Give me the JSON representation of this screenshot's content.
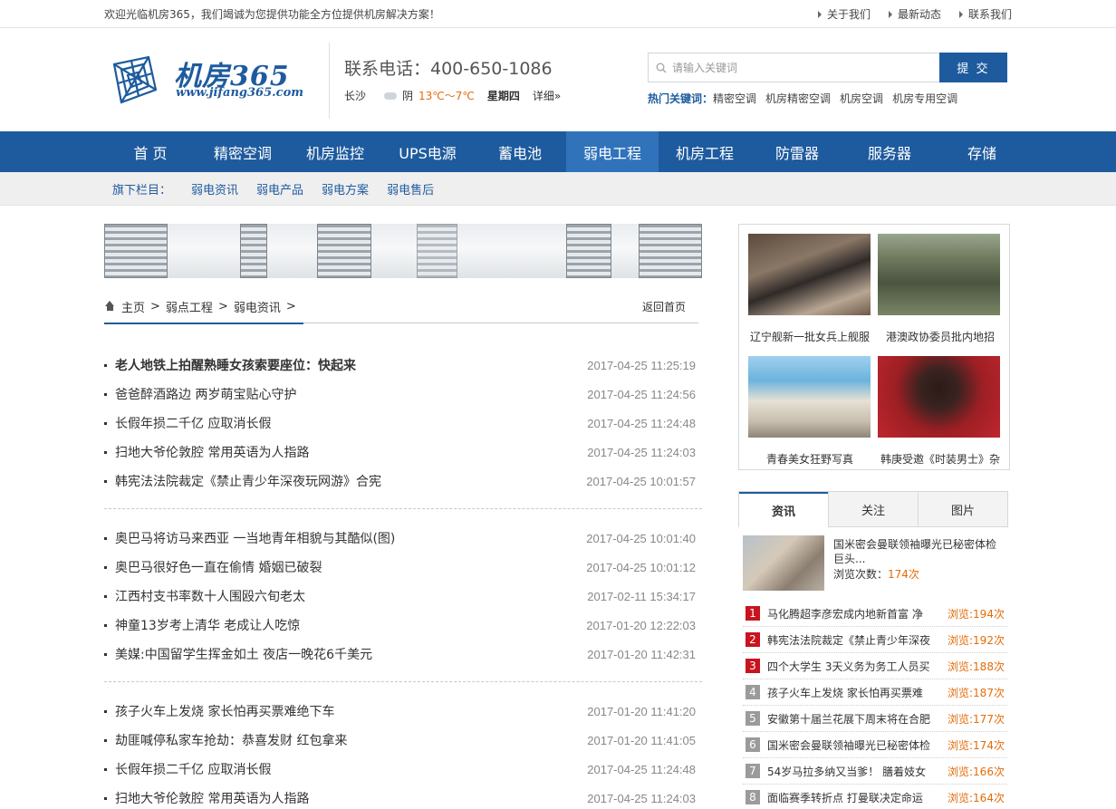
{
  "topbar": {
    "welcome": "欢迎光临机房365，我们竭诚为您提供功能全方位提供机房解决方案！",
    "links": [
      "关于我们",
      "最新动态",
      "联系我们"
    ]
  },
  "header": {
    "logo_main": "机房365",
    "logo_url": "www.jifang365.com",
    "phone": "联系电话：400-650-1086",
    "weather": {
      "city": "长沙",
      "cond": "阴",
      "temp": "13℃～7℃",
      "day": "星期四",
      "more": "详细»"
    },
    "search_placeholder": "请输入关键词",
    "search_button": "提 交",
    "hot_label": "热门关键词：",
    "hot_words": [
      "精密空调",
      "机房精密空调",
      "机房空调",
      "机房专用空调"
    ]
  },
  "nav": {
    "items": [
      "首 页",
      "精密空调",
      "机房监控",
      "UPS电源",
      "蓄电池",
      "弱电工程",
      "机房工程",
      "防雷器",
      "服务器",
      "存储"
    ],
    "active_index": 5
  },
  "subnav": {
    "label": "旗下栏目：",
    "items": [
      "弱电资讯",
      "弱电产品",
      "弱电方案",
      "弱电售后"
    ]
  },
  "breadcrumb": {
    "home": "主页",
    "sep": ">",
    "level1": "弱点工程",
    "level2": "弱电资讯",
    "back": "返回首页"
  },
  "news_groups": [
    [
      {
        "title": "老人地铁上拍醒熟睡女孩索要座位：快起来",
        "date": "2017-04-25 11:25:19",
        "bold": true
      },
      {
        "title": "爸爸醉酒路边 两岁萌宝贴心守护",
        "date": "2017-04-25 11:24:56"
      },
      {
        "title": "长假年损二千亿 应取消长假",
        "date": "2017-04-25 11:24:48"
      },
      {
        "title": "扫地大爷伦敦腔 常用英语为人指路",
        "date": "2017-04-25 11:24:03"
      },
      {
        "title": "韩宪法法院裁定《禁止青少年深夜玩网游》合宪",
        "date": "2017-04-25 10:01:57"
      }
    ],
    [
      {
        "title": "奥巴马将访马来西亚 一当地青年相貌与其酷似(图)",
        "date": "2017-04-25 10:01:40"
      },
      {
        "title": "奥巴马很好色一直在偷情 婚姻已破裂",
        "date": "2017-04-25 10:01:12"
      },
      {
        "title": "江西村支书率数十人围殴六旬老太",
        "date": "2017-02-11 15:34:17"
      },
      {
        "title": "神童13岁考上清华 老成让人吃惊",
        "date": "2017-01-20 12:22:03"
      },
      {
        "title": "美媒:中国留学生挥金如土 夜店一晚花6千美元",
        "date": "2017-01-20 11:42:31"
      }
    ],
    [
      {
        "title": "孩子火车上发烧 家长怕再买票难绝下车",
        "date": "2017-01-20 11:41:20"
      },
      {
        "title": "劫匪喊停私家车抢劫：恭喜发财 红包拿来",
        "date": "2017-01-20 11:41:05"
      },
      {
        "title": "长假年损二千亿 应取消长假",
        "date": "2017-04-25 11:24:48"
      },
      {
        "title": "扫地大爷伦敦腔 常用英语为人指路",
        "date": "2017-04-25 11:24:03"
      }
    ]
  ],
  "pictures": [
    {
      "caption": "辽宁舰新一批女兵上舰服"
    },
    {
      "caption": "港澳政协委员批内地招"
    },
    {
      "caption": "青春美女狂野写真"
    },
    {
      "caption": "韩庚受邀《时装男士》杂"
    }
  ],
  "tabs": {
    "items": [
      "资讯",
      "关注",
      "图片"
    ],
    "active_index": 0
  },
  "featured": {
    "title": "国米密会曼联领袖曝光已秘密体检巨头...",
    "views_label": "浏览次数：",
    "views": "174次"
  },
  "ranking": [
    {
      "n": "1",
      "title": "马化腾超李彦宏成内地新首富 净",
      "views": "浏览:194次"
    },
    {
      "n": "2",
      "title": "韩宪法法院裁定《禁止青少年深夜",
      "views": "浏览:192次"
    },
    {
      "n": "3",
      "title": "四个大学生 3天义务为务工人员买",
      "views": "浏览:188次"
    },
    {
      "n": "4",
      "title": "孩子火车上发烧 家长怕再买票难",
      "views": "浏览:187次"
    },
    {
      "n": "5",
      "title": "安徽第十届兰花展下周末将在合肥",
      "views": "浏览:177次"
    },
    {
      "n": "6",
      "title": "国米密会曼联领袖曝光已秘密体检",
      "views": "浏览:174次"
    },
    {
      "n": "7",
      "title": "54岁马拉多纳又当爹！ 膳着妓女",
      "views": "浏览:166次"
    },
    {
      "n": "8",
      "title": "面临赛季转折点 打曼联决定命运",
      "views": "浏览:164次"
    }
  ],
  "colors": {
    "brand": "#1e5b9e",
    "nav_active": "#3173bb",
    "accent_orange": "#e36c0a",
    "rank_red": "#c8141e"
  }
}
